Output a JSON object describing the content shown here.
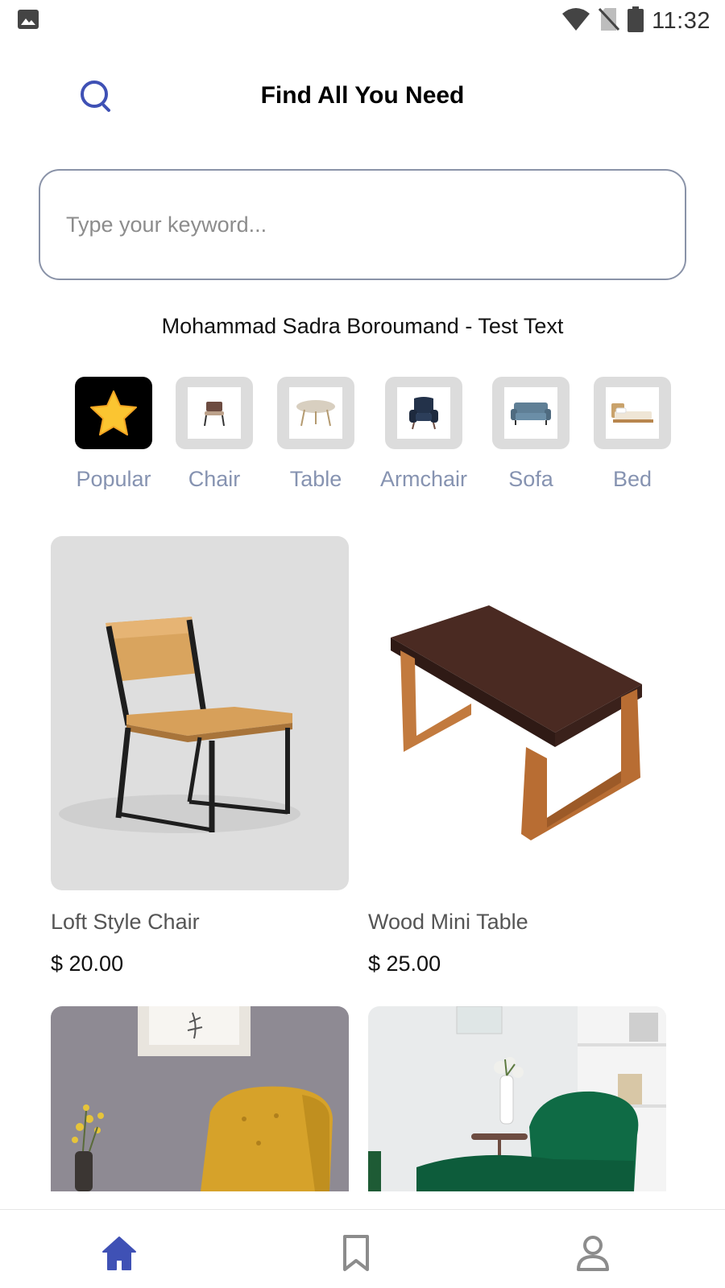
{
  "status_bar": {
    "time": "11:32"
  },
  "header": {
    "title": "Find All You Need"
  },
  "search": {
    "placeholder": "Type your keyword...",
    "value": ""
  },
  "subtitle": "Mohammad Sadra Boroumand - Test Text",
  "categories": [
    {
      "label": "Popular",
      "icon": "star-icon",
      "active": true
    },
    {
      "label": "Chair",
      "icon": "chair-thumbnail",
      "active": false
    },
    {
      "label": "Table",
      "icon": "table-thumbnail",
      "active": false
    },
    {
      "label": "Armchair",
      "icon": "armchair-thumbnail",
      "active": false
    },
    {
      "label": "Sofa",
      "icon": "sofa-thumbnail",
      "active": false
    },
    {
      "label": "Bed",
      "icon": "bed-thumbnail",
      "active": false
    }
  ],
  "products": [
    {
      "name": "Loft Style Chair",
      "price": "$ 20.00"
    },
    {
      "name": "Wood Mini Table",
      "price": "$ 25.00"
    }
  ],
  "bottom_nav": [
    {
      "icon": "home-icon",
      "active": true
    },
    {
      "icon": "bookmark-icon",
      "active": false
    },
    {
      "icon": "profile-icon",
      "active": false
    }
  ],
  "colors": {
    "accent": "#3f51b5",
    "category_label": "#8693b1",
    "inactive_icon": "#8c8c8c"
  }
}
